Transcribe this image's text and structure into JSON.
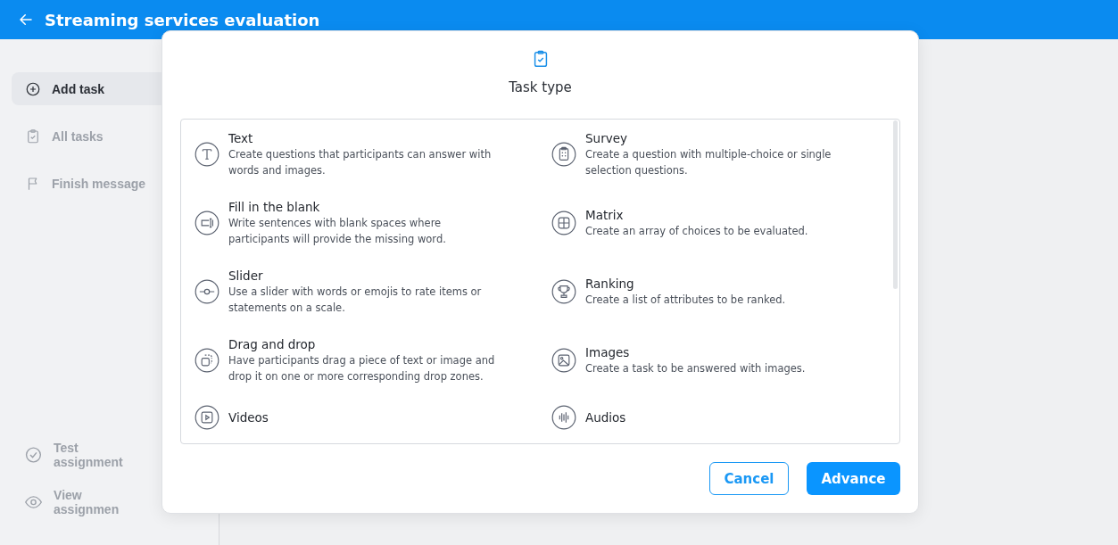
{
  "header": {
    "title": "Streaming services evaluation"
  },
  "sidebar": {
    "items": [
      {
        "label": "Add task",
        "selected": true
      },
      {
        "label": "All tasks",
        "selected": false
      },
      {
        "label": "Finish message",
        "selected": false
      }
    ],
    "bottom_items": [
      {
        "label": "Test assignment"
      },
      {
        "label": "View assignmen"
      }
    ]
  },
  "dialog": {
    "title": "Task type",
    "task_types": [
      {
        "title": "Text",
        "description": "Create questions that participants can answer with words and images."
      },
      {
        "title": "Survey",
        "description": "Create a question with multiple-choice or single selection questions."
      },
      {
        "title": "Fill in the blank",
        "description": "Write sentences with blank spaces where participants will provide the missing word."
      },
      {
        "title": "Matrix",
        "description": "Create an array of choices to be evaluated."
      },
      {
        "title": "Slider",
        "description": "Use a slider with words or emojis to rate items or statements on a scale."
      },
      {
        "title": "Ranking",
        "description": "Create a list of attributes to be ranked."
      },
      {
        "title": "Drag and drop",
        "description": "Have participants drag a piece of text or image and drop it on one or more corresponding drop zones."
      },
      {
        "title": "Images",
        "description": "Create a task to be answered with images."
      },
      {
        "title": "Videos"
      },
      {
        "title": "Audios"
      }
    ],
    "buttons": [
      {
        "label": "Cancel",
        "kind": "secondary"
      },
      {
        "label": "Advance",
        "kind": "primary"
      }
    ]
  }
}
